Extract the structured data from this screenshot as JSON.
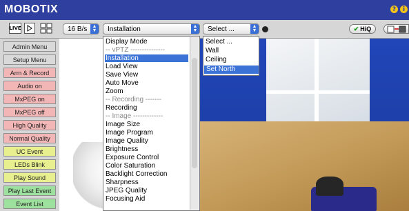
{
  "app": {
    "title": "MOBOTIX",
    "title_icons": [
      "?",
      "i"
    ]
  },
  "toolbar": {
    "live_label": "LIVE",
    "play_icon": "play-icon",
    "grid_icon": "grid-icon",
    "rate_value": "16 B/s",
    "mode_select_value": "Installation",
    "secondary_select_value": "Select ...",
    "hiq_label": "HiQ",
    "hiq_check": "✔"
  },
  "sidebar": {
    "items": [
      {
        "label": "Admin Menu",
        "color": "#d9d9d9"
      },
      {
        "label": "Setup Menu",
        "color": "#d9d9d9"
      },
      {
        "label": "Arm & Record",
        "color": "#f2b6b6"
      },
      {
        "label": "Audio on",
        "color": "#f2b6b6"
      },
      {
        "label": "MxPEG on",
        "color": "#f2b6b6"
      },
      {
        "label": "MxPEG off",
        "color": "#f2b6b6"
      },
      {
        "label": "High Quality",
        "color": "#f2b6b6"
      },
      {
        "label": "Normal Quality",
        "color": "#f2b6b6"
      },
      {
        "label": "UC Event",
        "color": "#e8ef8f"
      },
      {
        "label": "LEDs Blink",
        "color": "#e8ef8f"
      },
      {
        "label": "Play Sound",
        "color": "#e8ef8f"
      },
      {
        "label": "Play Last Event",
        "color": "#9ee09e"
      },
      {
        "label": "Event List",
        "color": "#9ee09e"
      }
    ]
  },
  "mode_dropdown": {
    "items": [
      {
        "label": "Display Mode",
        "type": "item"
      },
      {
        "label": "-- vPTZ ---------------",
        "type": "sep"
      },
      {
        "label": "Installation",
        "type": "item",
        "selected": true
      },
      {
        "label": "Load View",
        "type": "item"
      },
      {
        "label": "Save View",
        "type": "item"
      },
      {
        "label": "Auto Move",
        "type": "item"
      },
      {
        "label": "Zoom",
        "type": "item"
      },
      {
        "label": "-- Recording -------",
        "type": "sep"
      },
      {
        "label": "Recording",
        "type": "item"
      },
      {
        "label": "-- Image -------------",
        "type": "sep"
      },
      {
        "label": "Image Size",
        "type": "item"
      },
      {
        "label": "Image Program",
        "type": "item"
      },
      {
        "label": "Image Quality",
        "type": "item"
      },
      {
        "label": "Brightness",
        "type": "item"
      },
      {
        "label": "Exposure Control",
        "type": "item"
      },
      {
        "label": "Color Saturation",
        "type": "item"
      },
      {
        "label": "Backlight Correction",
        "type": "item"
      },
      {
        "label": "Sharpness",
        "type": "item"
      },
      {
        "label": "JPEG Quality",
        "type": "item"
      },
      {
        "label": "Focusing Aid",
        "type": "item"
      }
    ]
  },
  "secondary_dropdown": {
    "items": [
      {
        "label": "Select ...",
        "selected": false
      },
      {
        "label": "Wall",
        "selected": false
      },
      {
        "label": "Ceiling",
        "selected": false
      },
      {
        "label": "Set North",
        "selected": true
      }
    ]
  },
  "accent": {
    "title_bar": "#2f3fa0",
    "highlight": "#3b72d6"
  }
}
